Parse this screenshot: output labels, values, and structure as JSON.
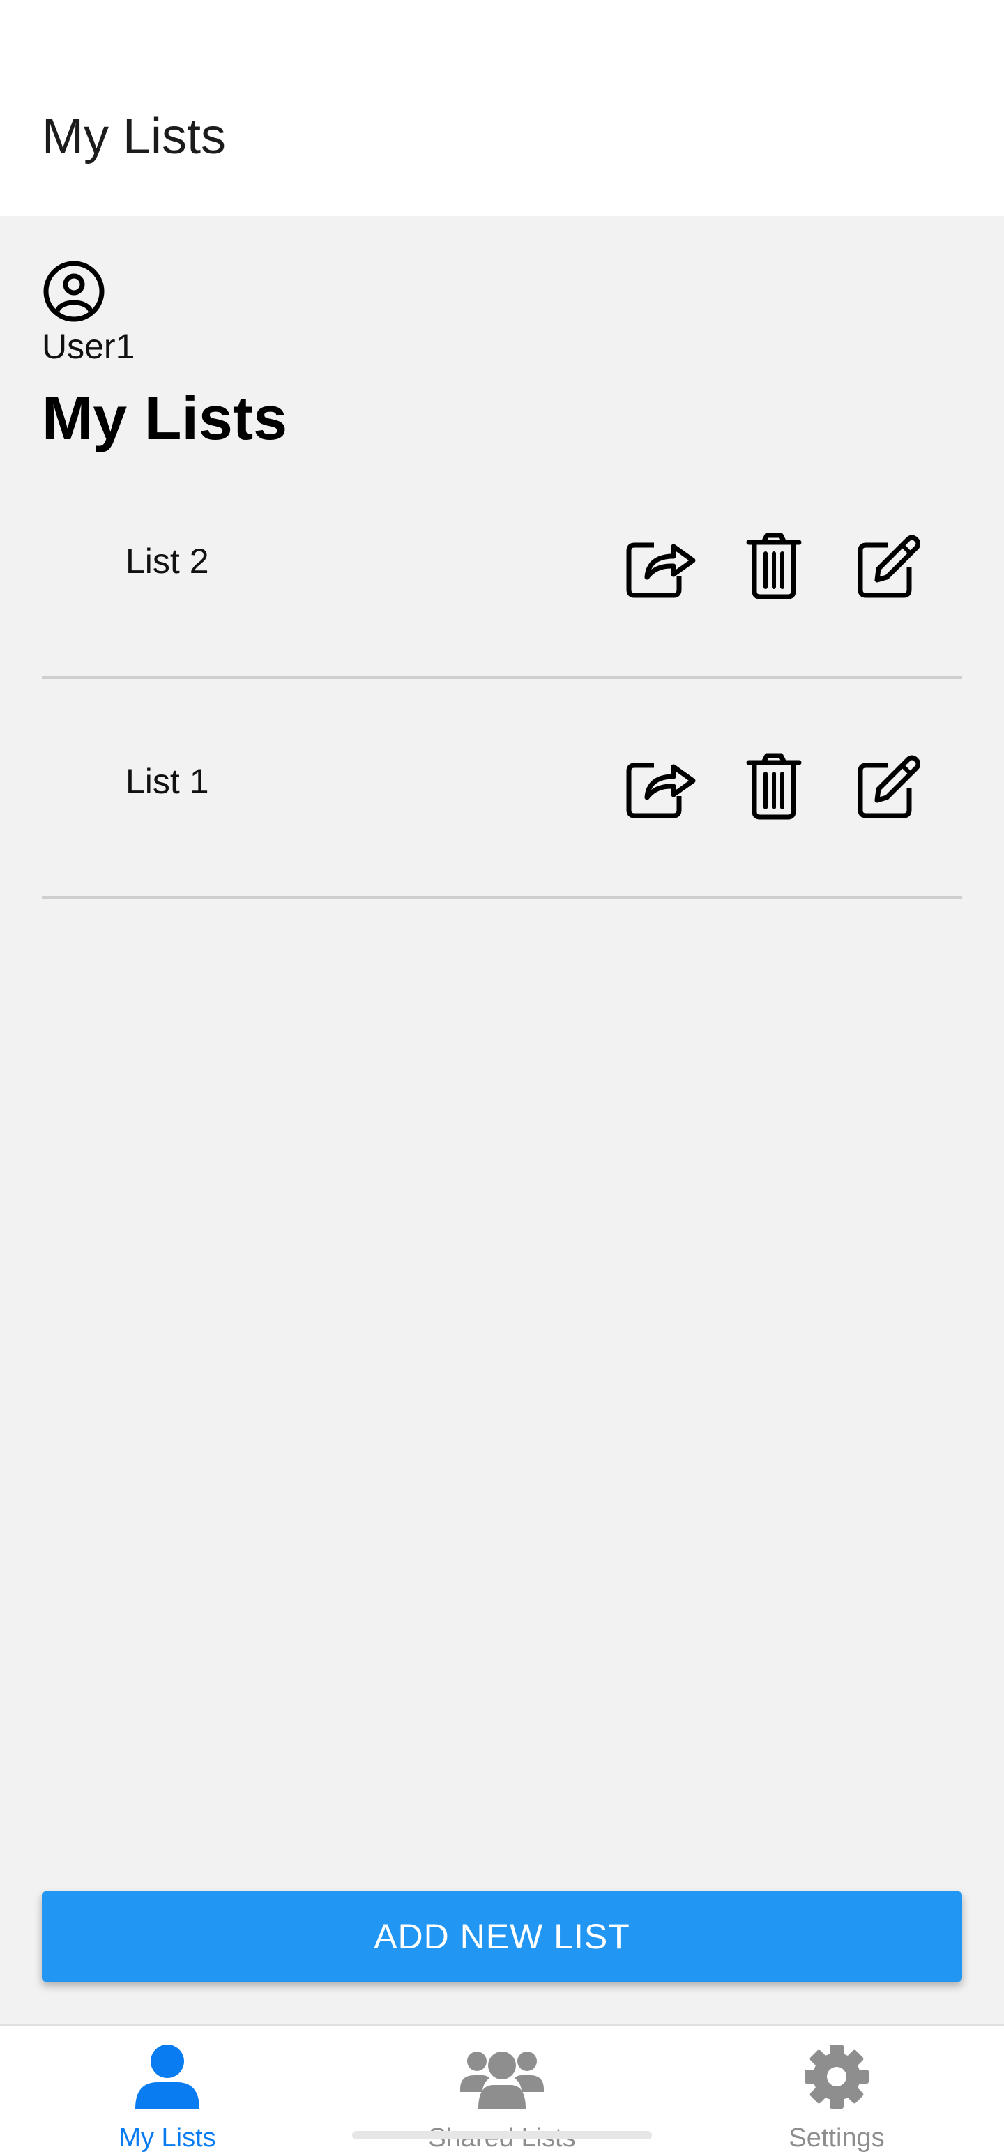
{
  "header": {
    "title": "My Lists"
  },
  "user": {
    "name": "User1",
    "icon": "user-circle-icon"
  },
  "section": {
    "title": "My Lists"
  },
  "lists": [
    {
      "label": "List 2"
    },
    {
      "label": "List 1"
    }
  ],
  "row_icons": [
    "share-icon",
    "trash-icon",
    "edit-icon"
  ],
  "actions": {
    "add_label": "ADD NEW LIST"
  },
  "tabs": [
    {
      "label": "My Lists",
      "icon": "user-icon",
      "active": true
    },
    {
      "label": "Shared Lists",
      "icon": "users-icon",
      "active": false
    },
    {
      "label": "Settings",
      "icon": "gear-icon",
      "active": false
    }
  ],
  "colors": {
    "accent": "#2196f3",
    "tab_active": "#0a7cf2",
    "tab_inactive": "#8e8e8e",
    "background": "#f2f2f2"
  }
}
